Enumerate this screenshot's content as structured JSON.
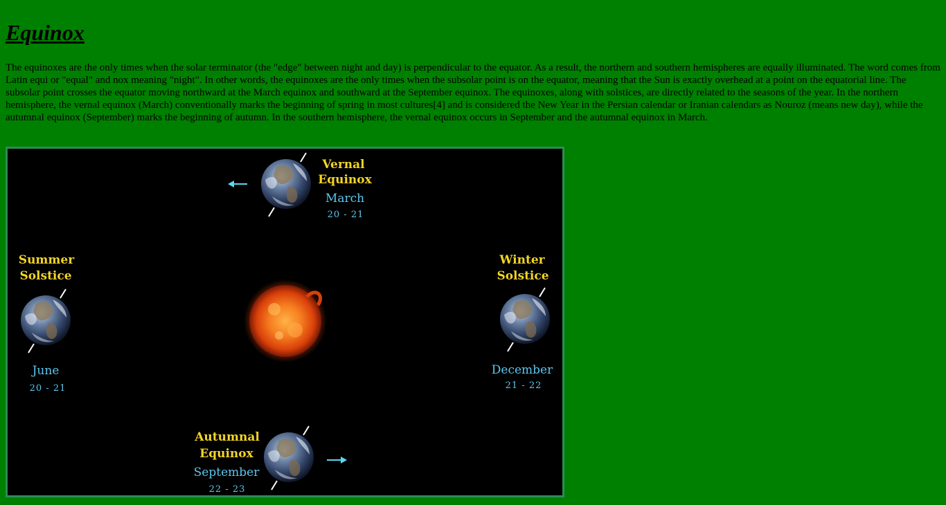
{
  "article": {
    "title": "Equinox",
    "paragraph": "The equinoxes are the only times when the solar terminator (the \"edge\" between night and day) is perpendicular to the equator. As a result, the northern and southern hemispheres are equally illuminated. The word comes from Latin equi or \"equal\" and nox meaning \"night\". In other words, the equinoxes are the only times when the subsolar point is on the equator, meaning that the Sun is exactly overhead at a point on the equatorial line. The subsolar point crosses the equator moving northward at the March equinox and southward at the September equinox. The equinoxes, along with solstices, are directly related to the seasons of the year. In the northern hemisphere, the vernal equinox (March) conventionally marks the beginning of spring in most cultures[4] and is considered the New Year in the Persian calendar or Iranian calendars as Nouroz (means new day), while the autumnal equinox (September) marks the beginning of autumn. In the southern hemisphere, the vernal equinox occurs in September and the autumnal equinox in March."
  },
  "diagram": {
    "vernal": {
      "line1": "Vernal",
      "line2": "Equinox",
      "month": "March",
      "dates": "20 - 21"
    },
    "summer": {
      "line1": "Summer",
      "line2": "Solstice",
      "month": "June",
      "dates": "20 - 21"
    },
    "winter": {
      "line1": "Winter",
      "line2": "Solstice",
      "month": "December",
      "dates": "21 - 22"
    },
    "autumnal": {
      "line1": "Autumnal",
      "line2": "Equinox",
      "month": "September",
      "dates": "22 - 23"
    },
    "colors": {
      "page_background": "#008000",
      "diagram_background": "#000000",
      "season_label": "#f3d526",
      "date_label": "#5cc8f0",
      "arrow": "#5cd8f0",
      "sun": "#e8530f"
    }
  }
}
